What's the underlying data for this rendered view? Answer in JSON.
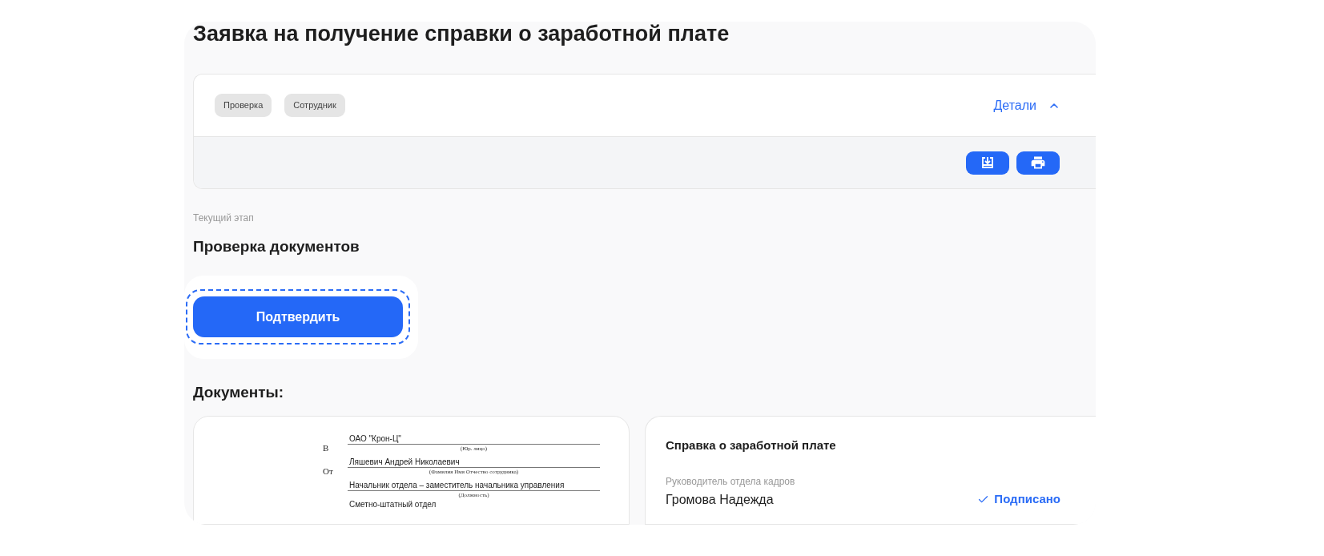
{
  "page": {
    "title": "Заявка на получение справки о заработной плате"
  },
  "card": {
    "tags": [
      "Проверка",
      "Сотрудник"
    ],
    "details": {
      "label": "Детали",
      "expanded": true
    },
    "actions": [
      {
        "kind": "download"
      },
      {
        "kind": "print"
      }
    ]
  },
  "stage": {
    "label": "Текущий этап",
    "value": "Проверка документов"
  },
  "confirm_button": {
    "label": "Подтвердить",
    "focused": true
  },
  "documents": {
    "heading": "Документы:",
    "preview": {
      "lines": [
        {
          "prefix": "В",
          "value": "ОАО \"Крон-Ц\"",
          "caption": "(Юр. лицо)"
        },
        {
          "prefix": "От",
          "value": "Ляшевич Андрей Николаевич",
          "caption": "(Фамилия Имя Отчество сотрудника)"
        },
        {
          "value": "Начальник отдела – заместитель начальника управления",
          "caption": "(Должность)"
        },
        {
          "value": "Сметно-штатный отдел"
        }
      ]
    },
    "signature": {
      "title": "Справка о заработной плате",
      "role": "Руководитель отдела кадров",
      "name": "Громова Надежда",
      "status": "Подписано",
      "signed": true
    }
  }
}
